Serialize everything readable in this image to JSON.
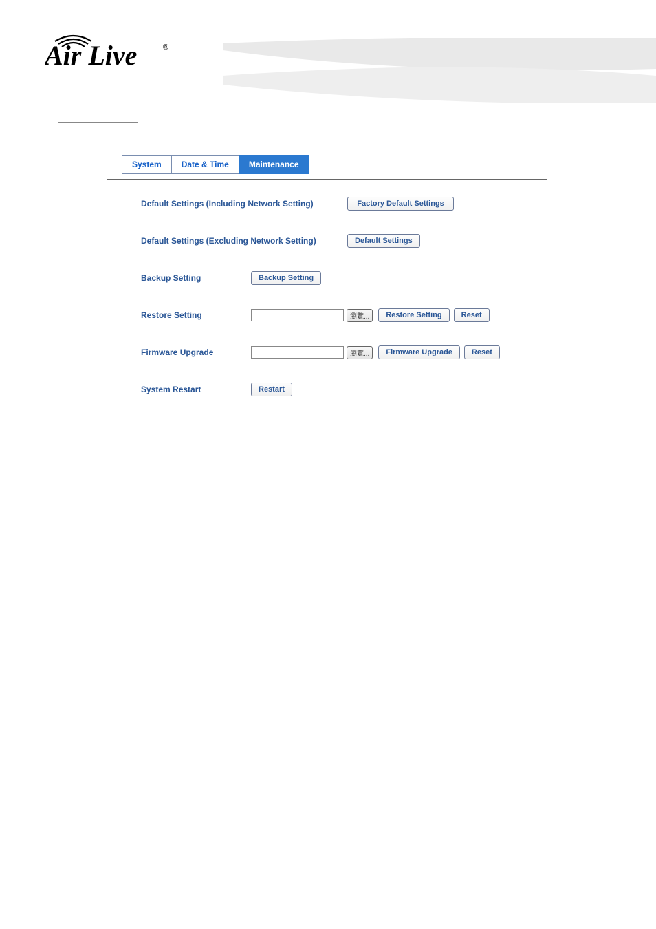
{
  "logo": {
    "text": "Air Live",
    "reg": "®"
  },
  "tabs": [
    {
      "label": "System",
      "active": false
    },
    {
      "label": "Date & Time",
      "active": false
    },
    {
      "label": "Maintenance",
      "active": true
    }
  ],
  "rows": {
    "factory": {
      "label": "Default Settings (Including Network Setting)",
      "button": "Factory Default Settings"
    },
    "default": {
      "label": "Default Settings (Excluding Network Setting)",
      "button": "Default Settings"
    },
    "backup": {
      "label": "Backup Setting",
      "button": "Backup Setting"
    },
    "restore": {
      "label": "Restore Setting",
      "browse": "瀏覽...",
      "action": "Restore Setting",
      "reset": "Reset"
    },
    "firmware": {
      "label": "Firmware Upgrade",
      "browse": "瀏覽...",
      "action": "Firmware Upgrade",
      "reset": "Reset"
    },
    "restart": {
      "label": "System Restart",
      "button": "Restart"
    }
  }
}
